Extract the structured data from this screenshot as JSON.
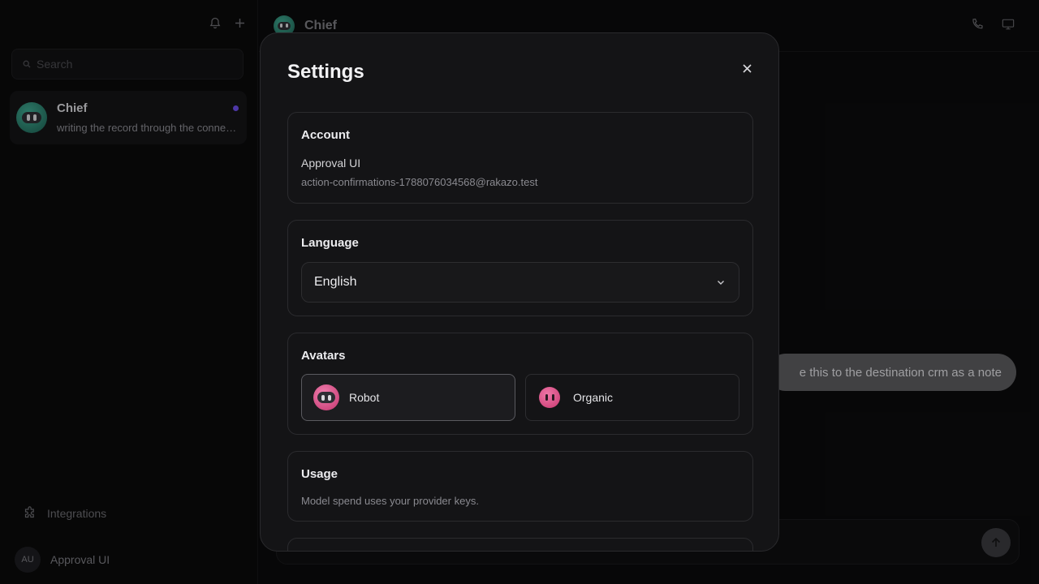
{
  "sidebar": {
    "search_placeholder": "Search",
    "chat": {
      "name": "Chief",
      "preview": "writing the record through the connector"
    },
    "integrations_label": "Integrations",
    "user": {
      "initials": "AU",
      "name": "Approval UI"
    }
  },
  "main": {
    "header_title": "Chief",
    "message": "e this to the destination crm as a note"
  },
  "modal": {
    "title": "Settings",
    "account": {
      "title": "Account",
      "name": "Approval UI",
      "email": "action-confirmations-1788076034568@rakazo.test"
    },
    "language": {
      "title": "Language",
      "selected": "English"
    },
    "avatars": {
      "title": "Avatars",
      "options": [
        {
          "label": "Robot",
          "selected": true
        },
        {
          "label": "Organic",
          "selected": false
        }
      ]
    },
    "usage": {
      "title": "Usage",
      "note": "Model spend uses your provider keys."
    }
  },
  "colors": {
    "accent_dot": "#6b4de6",
    "robot_teal": "#3fa890",
    "avatar_pink": "#e85a95"
  },
  "icons": [
    "bell-icon",
    "plus-icon",
    "search-icon",
    "puzzle-icon",
    "phone-icon",
    "monitor-icon",
    "close-icon",
    "chevron-down-icon",
    "arrow-up-icon"
  ]
}
